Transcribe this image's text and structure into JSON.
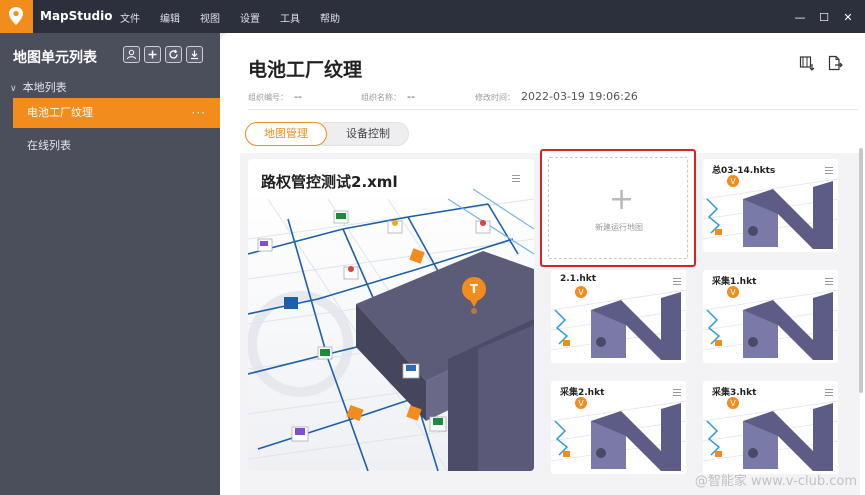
{
  "app": {
    "name": "MapStudio"
  },
  "menu": [
    "文件",
    "编辑",
    "视图",
    "设置",
    "工具",
    "帮助"
  ],
  "sidebar": {
    "title": "地图单元列表",
    "local_group": "本地列表",
    "active_item": "电池工厂纹理",
    "active_item_more": "···",
    "online_group": "在线列表"
  },
  "header": {
    "title": "电池工厂纹理",
    "group_id_label": "组织编号：",
    "group_id_value": "--",
    "group_name_label": "组织名称：",
    "group_name_value": "--",
    "modified_label": "修改时间：",
    "modified_value": "2022-03-19 19:06:26"
  },
  "tabs": [
    {
      "label": "地图管理",
      "active": true
    },
    {
      "label": "设备控制",
      "active": false
    }
  ],
  "main_map": {
    "title": "路权管控测试2.xml"
  },
  "new_map": {
    "label": "新建运行地图"
  },
  "maps": [
    {
      "title": "总03-14.hkts"
    },
    {
      "title": "2.1.hkt"
    },
    {
      "title": "采集1.hkt"
    },
    {
      "title": "采集2.hkt"
    },
    {
      "title": "采集3.hkt"
    }
  ],
  "watermark": "@智能家  www.v-club.com",
  "colors": {
    "accent": "#f28c1c",
    "sidebar": "#4b4e5b",
    "titlebar": "#2c2f3c",
    "highlight": "#d32525"
  }
}
